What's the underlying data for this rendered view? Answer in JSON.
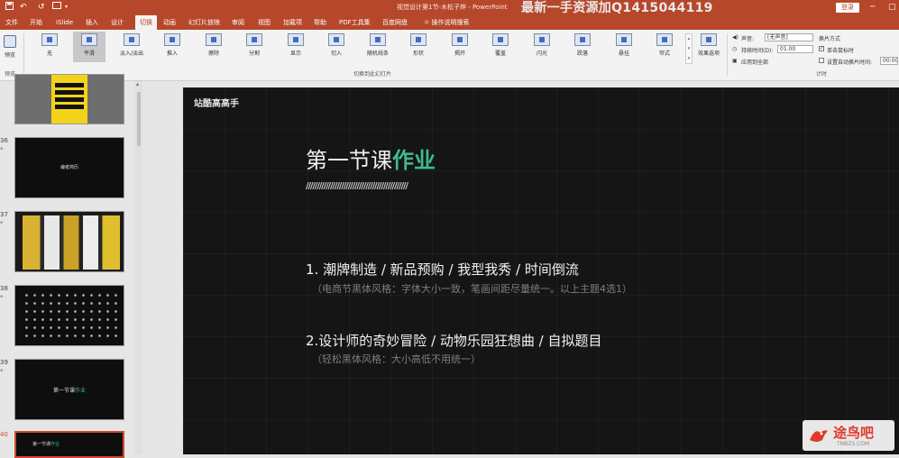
{
  "titlebar": {
    "save_icon": "save-icon",
    "undo_icon": "undo-icon",
    "redo_icon": "redo-icon",
    "title": "视觉设计第1节-木松子烨 - PowerPoint",
    "watermark": "最新一手资源加Q1415044119",
    "login": "登录",
    "brand_color": "#b7472a"
  },
  "tabs": [
    "文件",
    "开始",
    "iSlide",
    "插入",
    "设计",
    "切换",
    "动画",
    "幻灯片放映",
    "审阅",
    "视图",
    "加载项",
    "帮助",
    "PDF工具集",
    "百度网盘",
    "操作说明搜索"
  ],
  "active_tab": "切换",
  "ribbon": {
    "preview_label": "预览",
    "preview_group": "预览",
    "transitions": [
      {
        "label": "无",
        "selected": false
      },
      {
        "label": "平滑",
        "selected": true
      },
      {
        "label": "淡入/淡出",
        "selected": false
      },
      {
        "label": "推入",
        "selected": false
      },
      {
        "label": "擦除",
        "selected": false
      },
      {
        "label": "分割",
        "selected": false
      },
      {
        "label": "显示",
        "selected": false
      },
      {
        "label": "切入",
        "selected": false
      },
      {
        "label": "随机线条",
        "selected": false
      },
      {
        "label": "形状",
        "selected": false
      },
      {
        "label": "揭开",
        "selected": false
      },
      {
        "label": "覆盖",
        "selected": false
      },
      {
        "label": "闪光",
        "selected": false
      },
      {
        "label": "跌落",
        "selected": false
      },
      {
        "label": "悬挂",
        "selected": false
      },
      {
        "label": "帘式",
        "selected": false
      }
    ],
    "effect_options": "效果选项",
    "group_transitions": "切换到此幻灯片",
    "sound_label": "声音:",
    "sound_value": "[无声音]",
    "duration_label": "持续时间(D):",
    "duration_value": "01.00",
    "apply_all": "应用到全部",
    "advance_label": "换片方式",
    "on_click": "单击鼠标时",
    "after_label": "设置自动换片时间:",
    "after_value": "00:00.00",
    "timing_group": "计时"
  },
  "thumbnails": [
    {
      "num": "",
      "star": "",
      "caption": ""
    },
    {
      "num": "36",
      "star": "*",
      "caption": "编者简历"
    },
    {
      "num": "37",
      "star": "*",
      "caption": ""
    },
    {
      "num": "38",
      "star": "*",
      "caption": ""
    },
    {
      "num": "39",
      "star": "*",
      "caption_main": "第一节课",
      "caption_accent": "作业"
    },
    {
      "num": "40",
      "star": "",
      "caption_main": "第一节课",
      "caption_accent": "作业"
    }
  ],
  "slide": {
    "brand": "站酷高高手",
    "title_main": "第一节课",
    "title_accent": "作业",
    "slashes": "//////////////////////////////////////////////",
    "item1": "1. 潮牌制造 /  新品预购  /  我型我秀 /  时间倒流",
    "item1_note": "（电商节黑体风格：字体大小一致，笔画间距尽量统一。以上主题4选1）",
    "item2": "2.设计师的奇妙冒险 /  动物乐园狂想曲 / 自拟题目",
    "item2_note": "（轻松黑体风格：大小高低不用统一）",
    "accent_color": "#3dbb8e"
  },
  "watermark_br": {
    "name": "途鸟吧",
    "url": "TNBZS.COM"
  }
}
